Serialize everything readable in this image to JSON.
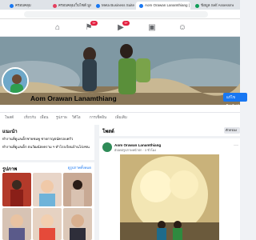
{
  "browser": {
    "tabs": [
      {
        "label": "ครอบคลุม",
        "color": "#1877f2",
        "active": false
      },
      {
        "label": "ครอบคลุมเว็บไซต์ มูลนิธิ",
        "color": "#e4405f",
        "active": false
      },
      {
        "label": "Meta Business Suite",
        "color": "#1877f2",
        "active": false
      },
      {
        "label": "Aom Orawan Lanamthiang | Fac",
        "color": "#1877f2",
        "active": true
      },
      {
        "label": "ข้อมูล Self Assessment",
        "color": "#0f9d58",
        "active": false
      }
    ]
  },
  "fb_header": {
    "notification_badge": "9+",
    "messages_badge": "9+"
  },
  "profile": {
    "name": "Aom Orawan Lanamthiang",
    "edit_button": "แก้ไขโปรไฟล์",
    "tabs": [
      "โพสต์",
      "เกี่ยวกับ",
      "เพื่อน",
      "รูปภาพ",
      "วิดีโอ",
      "การเช็คอิน",
      "เพิ่มเติม"
    ]
  },
  "intro": {
    "title": "แนะนำ",
    "lines": [
      "ทำงานที่ดูแลเด็กชายชมพู ชายกาญจน์ครอบครัว",
      "ทำงานที่ดูแลเด็ก ธนวัฒน์สงคราม ฯ ทำโรงเรียนบ้านโป่งชน"
    ]
  },
  "photos": {
    "title": "รูปภาพ",
    "see_all": "ดูรูปภาพทั้งหมด"
  },
  "posts": {
    "title": "โพสต์",
    "filter": "ตัวกรอง",
    "author": "Aom Orawan Lanamthiang",
    "meta": "อัปเดตรูปภาพหน้าปก · 3 ชั่วโมง"
  },
  "icons": [
    "home-icon",
    "flag-icon",
    "watch-icon",
    "marketplace-icon",
    "groups-icon",
    "more-icon"
  ]
}
